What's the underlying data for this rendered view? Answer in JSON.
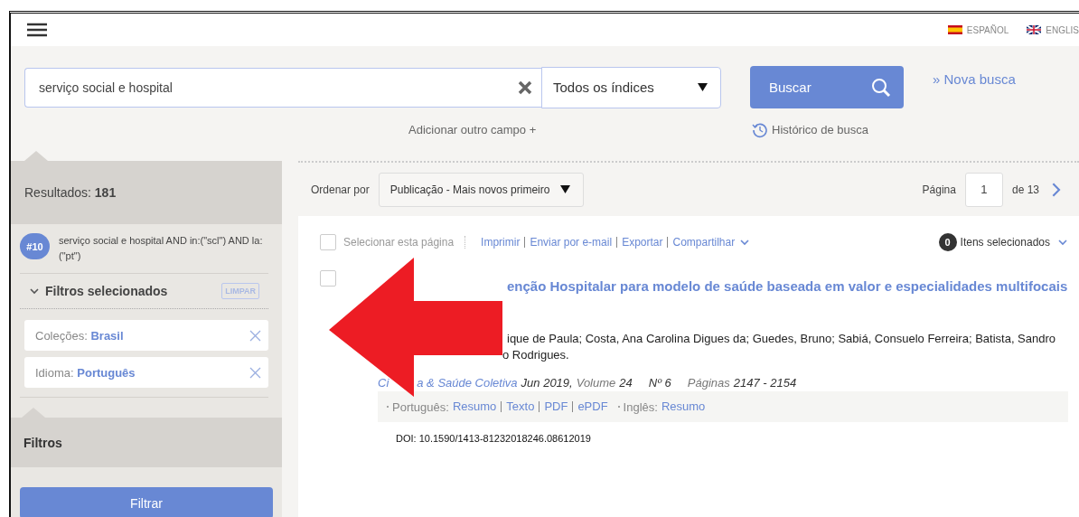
{
  "header": {
    "languages": [
      {
        "kind": "es",
        "label": "ESPAÑOL"
      },
      {
        "kind": "uk",
        "label": "ENGLIS"
      }
    ]
  },
  "search": {
    "value": "serviço social e hospital",
    "index_select": "Todos os índices",
    "button": "Buscar",
    "new_search": "» Nova busca",
    "add_field": "Adicionar outro campo +",
    "history": "Histórico de busca"
  },
  "sidebar": {
    "results_label": "Resultados:",
    "results_count": "181",
    "query": {
      "number": "#10",
      "text": "serviço social e hospital AND in:(\"scl\") AND la:(\"pt\")"
    },
    "selected_filters": {
      "title": "Filtros selecionados",
      "expanded": true,
      "clear": "LIMPAR",
      "items": [
        {
          "label": "Coleções:",
          "value": "Brasil"
        },
        {
          "label": "Idioma:",
          "value": "Português"
        }
      ]
    },
    "filters_title": "Filtros",
    "filter_button": "Filtrar"
  },
  "toolbar": {
    "sort_label": "Ordenar por",
    "sort_value": "Publicação - Mais novos primeiro",
    "page_label": "Página",
    "page": "1",
    "page_total": "de 13"
  },
  "actions": {
    "select_page": {
      "label": "Selecionar esta página",
      "checked": false
    },
    "links": [
      "Imprimir",
      "Enviar por e-mail",
      "Exportar",
      "Compartilhar"
    ],
    "selected_count": "0",
    "selected_label": "Itens selecionados"
  },
  "results": [
    {
      "checked": false,
      "title": "enção Hospitalar para modelo de saúde baseada em valor e especialidades multifocais",
      "authors": [
        "ique de Paula; Costa, Ana Carolina Digues da; Guedes, Bruno; Sabiá, Consuelo Ferreira; Batista, Sandro",
        "o Rodrigues."
      ],
      "journal_parts": [
        "Ci",
        "a & Saúde Coletiva"
      ],
      "date": "Jun 2019,",
      "volume_label": "Volume",
      "volume": "24",
      "number": "Nº 6",
      "pages_label": "Páginas",
      "pages": "2147 - 2154",
      "languages": [
        {
          "label": "Português:",
          "links": [
            "Resumo",
            "Texto",
            "PDF",
            "ePDF"
          ]
        },
        {
          "label": "Inglês:",
          "links": [
            "Resumo"
          ]
        }
      ],
      "doi": "DOI: 10.1590/1413-81232018246.08612019"
    }
  ]
}
